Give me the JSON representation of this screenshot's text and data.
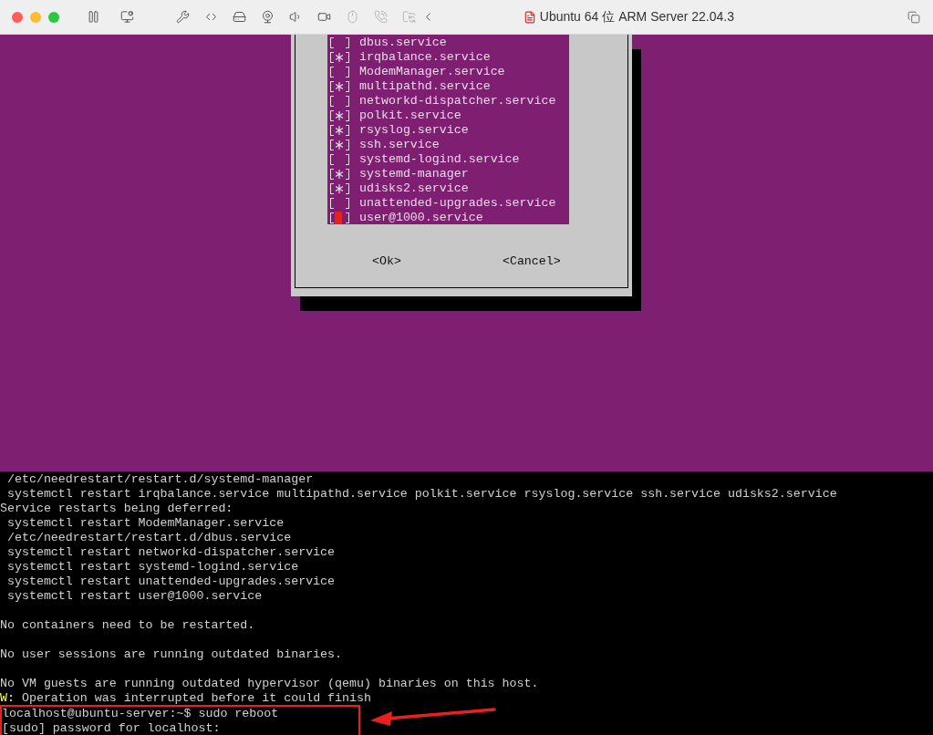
{
  "window": {
    "title": "Ubuntu 64 位 ARM Server 22.04.3"
  },
  "dialog": {
    "items": [
      {
        "label": "dbus.service",
        "checked": false,
        "focused": false
      },
      {
        "label": "irqbalance.service",
        "checked": true,
        "focused": false
      },
      {
        "label": "ModemManager.service",
        "checked": false,
        "focused": false
      },
      {
        "label": "multipathd.service",
        "checked": true,
        "focused": false
      },
      {
        "label": "networkd-dispatcher.service",
        "checked": false,
        "focused": false
      },
      {
        "label": "polkit.service",
        "checked": true,
        "focused": false
      },
      {
        "label": "rsyslog.service",
        "checked": true,
        "focused": false
      },
      {
        "label": "ssh.service",
        "checked": true,
        "focused": false
      },
      {
        "label": "systemd-logind.service",
        "checked": false,
        "focused": false
      },
      {
        "label": "systemd-manager",
        "checked": true,
        "focused": false
      },
      {
        "label": "udisks2.service",
        "checked": true,
        "focused": false
      },
      {
        "label": "unattended-upgrades.service",
        "checked": false,
        "focused": false
      },
      {
        "label": "user@1000.service",
        "checked": false,
        "focused": true
      }
    ],
    "buttons": [
      "<Ok>",
      "<Cancel>"
    ]
  },
  "terminal": {
    "lines": [
      {
        "kind": "text",
        "text": " /etc/needrestart/restart.d/systemd-manager"
      },
      {
        "kind": "text",
        "text": " systemctl restart irqbalance.service multipathd.service polkit.service rsyslog.service ssh.service udisks2.service"
      },
      {
        "kind": "text",
        "text": "Service restarts being deferred:"
      },
      {
        "kind": "text",
        "text": " systemctl restart ModemManager.service"
      },
      {
        "kind": "text",
        "text": " /etc/needrestart/restart.d/dbus.service"
      },
      {
        "kind": "text",
        "text": " systemctl restart networkd-dispatcher.service"
      },
      {
        "kind": "text",
        "text": " systemctl restart systemd-logind.service"
      },
      {
        "kind": "text",
        "text": " systemctl restart unattended-upgrades.service"
      },
      {
        "kind": "text",
        "text": " systemctl restart user@1000.service"
      },
      {
        "kind": "blank"
      },
      {
        "kind": "text",
        "text": "No containers need to be restarted."
      },
      {
        "kind": "blank"
      },
      {
        "kind": "text",
        "text": "No user sessions are running outdated binaries."
      },
      {
        "kind": "blank"
      },
      {
        "kind": "text",
        "text": "No VM guests are running outdated hypervisor (qemu) binaries on this host."
      },
      {
        "kind": "warning",
        "prefix": "W:",
        "text": "Operation was interrupted before it could finish"
      }
    ],
    "highlighted_lines": [
      {
        "kind": "text",
        "text": "localhost@ubuntu-server:~$ sudo reboot"
      },
      {
        "kind": "text",
        "text": "[sudo] password for localhost:"
      }
    ]
  }
}
